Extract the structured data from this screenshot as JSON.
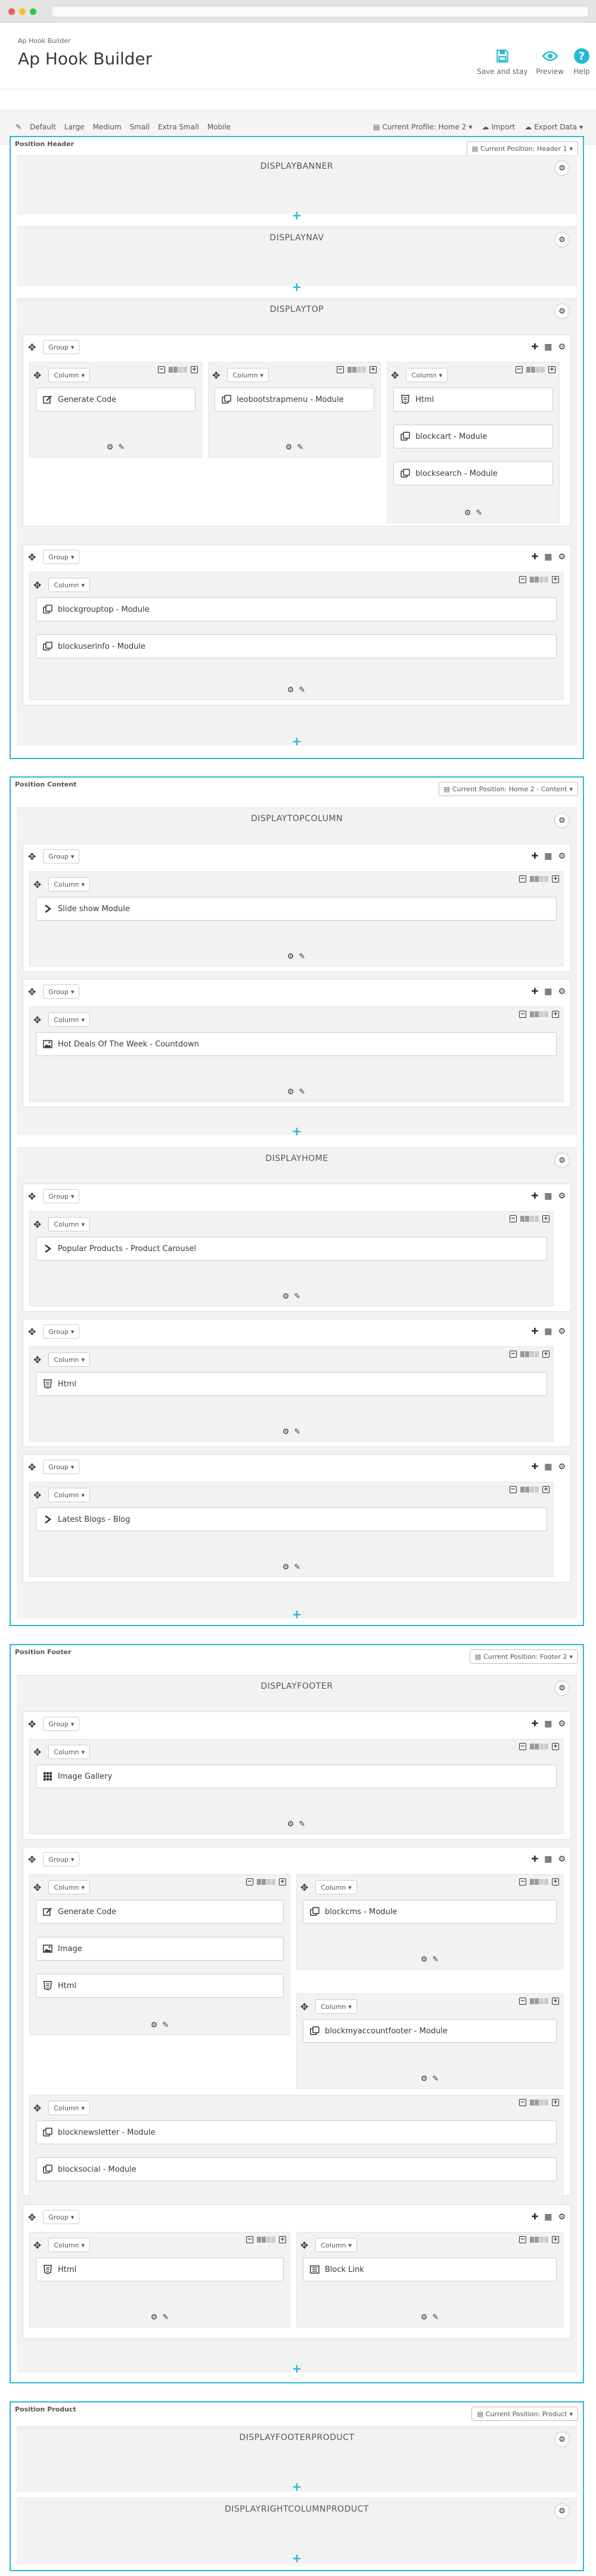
{
  "header": {
    "breadcrumb": "Ap Hook Builder",
    "title": "Ap Hook Builder",
    "save_label": "Save and stay",
    "preview_label": "Preview",
    "help_label": "Help"
  },
  "toolbar": {
    "sizes": [
      "Default",
      "Large",
      "Medium",
      "Small",
      "Extra Small",
      "Mobile"
    ],
    "current_profile": "Current Profile: Home 2",
    "import": "Import",
    "export": "Export Data"
  },
  "labels": {
    "group": "Group",
    "column": "Column"
  },
  "positions": [
    {
      "title": "Position Header",
      "current": "Current Position: Header 1",
      "hooks": [
        {
          "name": "DISPLAYBANNER",
          "groups": []
        },
        {
          "name": "DISPLAYNAV",
          "groups": []
        },
        {
          "name": "DISPLAYTOP",
          "groups": [
            {
              "columns": [
                {
                  "modules": [
                    {
                      "label": "Generate Code",
                      "icon": "edit-icon"
                    }
                  ]
                },
                {
                  "modules": [
                    {
                      "label": "leobootstrapmenu - Module",
                      "icon": "module-icon"
                    }
                  ]
                },
                {
                  "modules": [
                    {
                      "label": "Html",
                      "icon": "html5-icon"
                    },
                    {
                      "label": "blockcart - Module",
                      "icon": "module-icon"
                    },
                    {
                      "label": "blocksearch - Module",
                      "icon": "module-icon"
                    }
                  ]
                }
              ]
            },
            {
              "columns": [
                {
                  "modules": [
                    {
                      "label": "blockgrouptop - Module",
                      "icon": "module-icon"
                    },
                    {
                      "label": "blockuserinfo - Module",
                      "icon": "module-icon"
                    }
                  ]
                }
              ]
            }
          ]
        }
      ]
    },
    {
      "title": "Position Content",
      "current": "Current Position: Home 2 - Content",
      "hooks": [
        {
          "name": "DISPLAYTOPCOLUMN",
          "groups": [
            {
              "columns": [
                {
                  "modules": [
                    {
                      "label": "Slide show Module",
                      "icon": "chevron-right-icon"
                    }
                  ]
                }
              ]
            },
            {
              "columns": [
                {
                  "modules": [
                    {
                      "label": "Hot Deals Of The Week - Countdown",
                      "icon": "image-icon"
                    }
                  ]
                }
              ]
            }
          ]
        },
        {
          "name": "DISPLAYHOME",
          "groups": [
            {
              "columns": [
                {
                  "modules": [
                    {
                      "label": "Popular Products - Product Carousel",
                      "icon": "chevron-right-icon"
                    }
                  ]
                }
              ]
            },
            {
              "columns": [
                {
                  "modules": [
                    {
                      "label": "Html",
                      "icon": "html5-icon"
                    }
                  ]
                }
              ]
            },
            {
              "columns": [
                {
                  "modules": [
                    {
                      "label": "Latest Blogs - Blog",
                      "icon": "chevron-right-icon"
                    }
                  ]
                }
              ]
            }
          ]
        }
      ]
    },
    {
      "title": "Position Footer",
      "current": "Current Position: Footer 2",
      "hooks": [
        {
          "name": "DISPLAYFOOTER",
          "groups": [
            {
              "columns": [
                {
                  "modules": [
                    {
                      "label": "Image Gallery",
                      "icon": "grid-icon"
                    }
                  ]
                }
              ]
            },
            {
              "columns": [
                {
                  "modules": [
                    {
                      "label": "Generate Code",
                      "icon": "edit-icon"
                    },
                    {
                      "label": "Image",
                      "icon": "image-icon"
                    },
                    {
                      "label": "Html",
                      "icon": "html5-icon"
                    }
                  ]
                },
                {
                  "modules": [
                    {
                      "label": "blockcms - Module",
                      "icon": "module-icon"
                    }
                  ]
                },
                {
                  "modules": [
                    {
                      "label": "blockmyaccountfooter - Module",
                      "icon": "module-icon"
                    }
                  ]
                },
                {
                  "modules": [
                    {
                      "label": "blocknewsletter - Module",
                      "icon": "module-icon"
                    },
                    {
                      "label": "blocksocial - Module",
                      "icon": "module-icon"
                    }
                  ]
                }
              ]
            },
            {
              "columns": [
                {
                  "modules": [
                    {
                      "label": "Html",
                      "icon": "html5-icon"
                    }
                  ]
                },
                {
                  "modules": [
                    {
                      "label": "Block Link",
                      "icon": "list-icon"
                    }
                  ]
                }
              ]
            }
          ]
        }
      ]
    },
    {
      "title": "Position Product",
      "current": "Current Position: Product",
      "hooks": [
        {
          "name": "DISPLAYFOOTERPRODUCT",
          "groups": []
        },
        {
          "name": "DISPLAYRIGHTCOLUMNPRODUCT",
          "groups": []
        }
      ]
    }
  ]
}
